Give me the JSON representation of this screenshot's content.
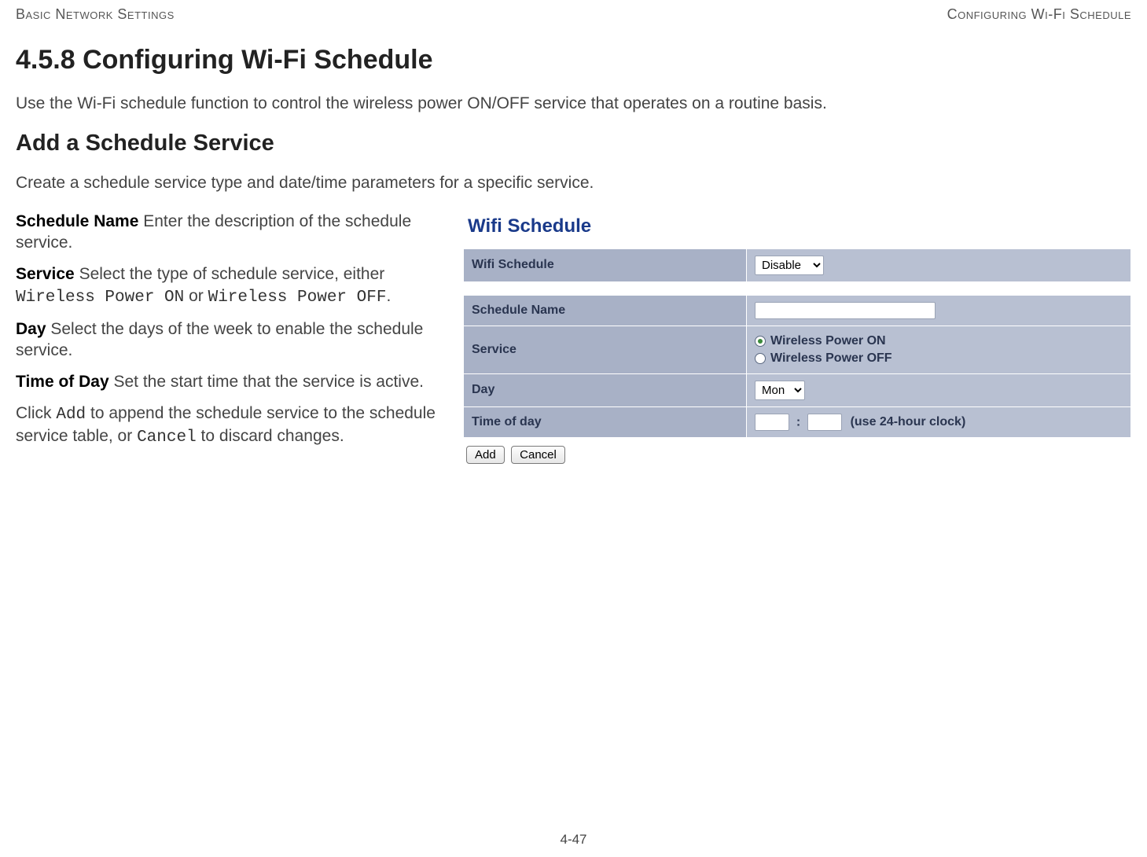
{
  "header": {
    "left": "Basic Network Settings",
    "right": "Configuring Wi-Fi Schedule"
  },
  "section_number_title": "4.5.8 Configuring Wi-Fi Schedule",
  "intro": "Use the Wi-Fi schedule function to control the wireless power ON/OFF service that operates on a routine basis.",
  "subsection_title": "Add a Schedule Service",
  "sub_intro": "Create a schedule service type and date/time parameters for a specific service.",
  "defs": {
    "schedule_name_label": "Schedule Name",
    "schedule_name_text": " Enter the description of the schedule service.",
    "service_label": "Service",
    "service_text_a": " Select the type of schedule service, either ",
    "service_opt_on": "Wireless Power ON",
    "service_text_or": " or ",
    "service_opt_off": "Wireless Power OFF",
    "service_text_end": ".",
    "day_label": "Day",
    "day_text": " Select the days of the week to enable the schedule service.",
    "tod_label": "Time of Day",
    "tod_text": " Set the start time that the service is active.",
    "click_text_a": "Click ",
    "click_add": "Add",
    "click_text_b": " to append the schedule service to the schedule service table, or ",
    "click_cancel": "Cancel",
    "click_text_c": " to discard changes."
  },
  "panel": {
    "title": "Wifi Schedule",
    "rows": {
      "wifi_schedule_label": "Wifi Schedule",
      "wifi_schedule_value": "Disable",
      "schedule_name_label": "Schedule Name",
      "schedule_name_value": "",
      "service_label": "Service",
      "service_on": "Wireless Power ON",
      "service_off": "Wireless Power OFF",
      "service_selected": "on",
      "day_label": "Day",
      "day_value": "Mon",
      "tod_label": "Time of day",
      "tod_hour": "",
      "tod_minute": "",
      "tod_hint": "(use 24-hour clock)"
    },
    "buttons": {
      "add": "Add",
      "cancel": "Cancel"
    }
  },
  "footer_page": "4-47"
}
